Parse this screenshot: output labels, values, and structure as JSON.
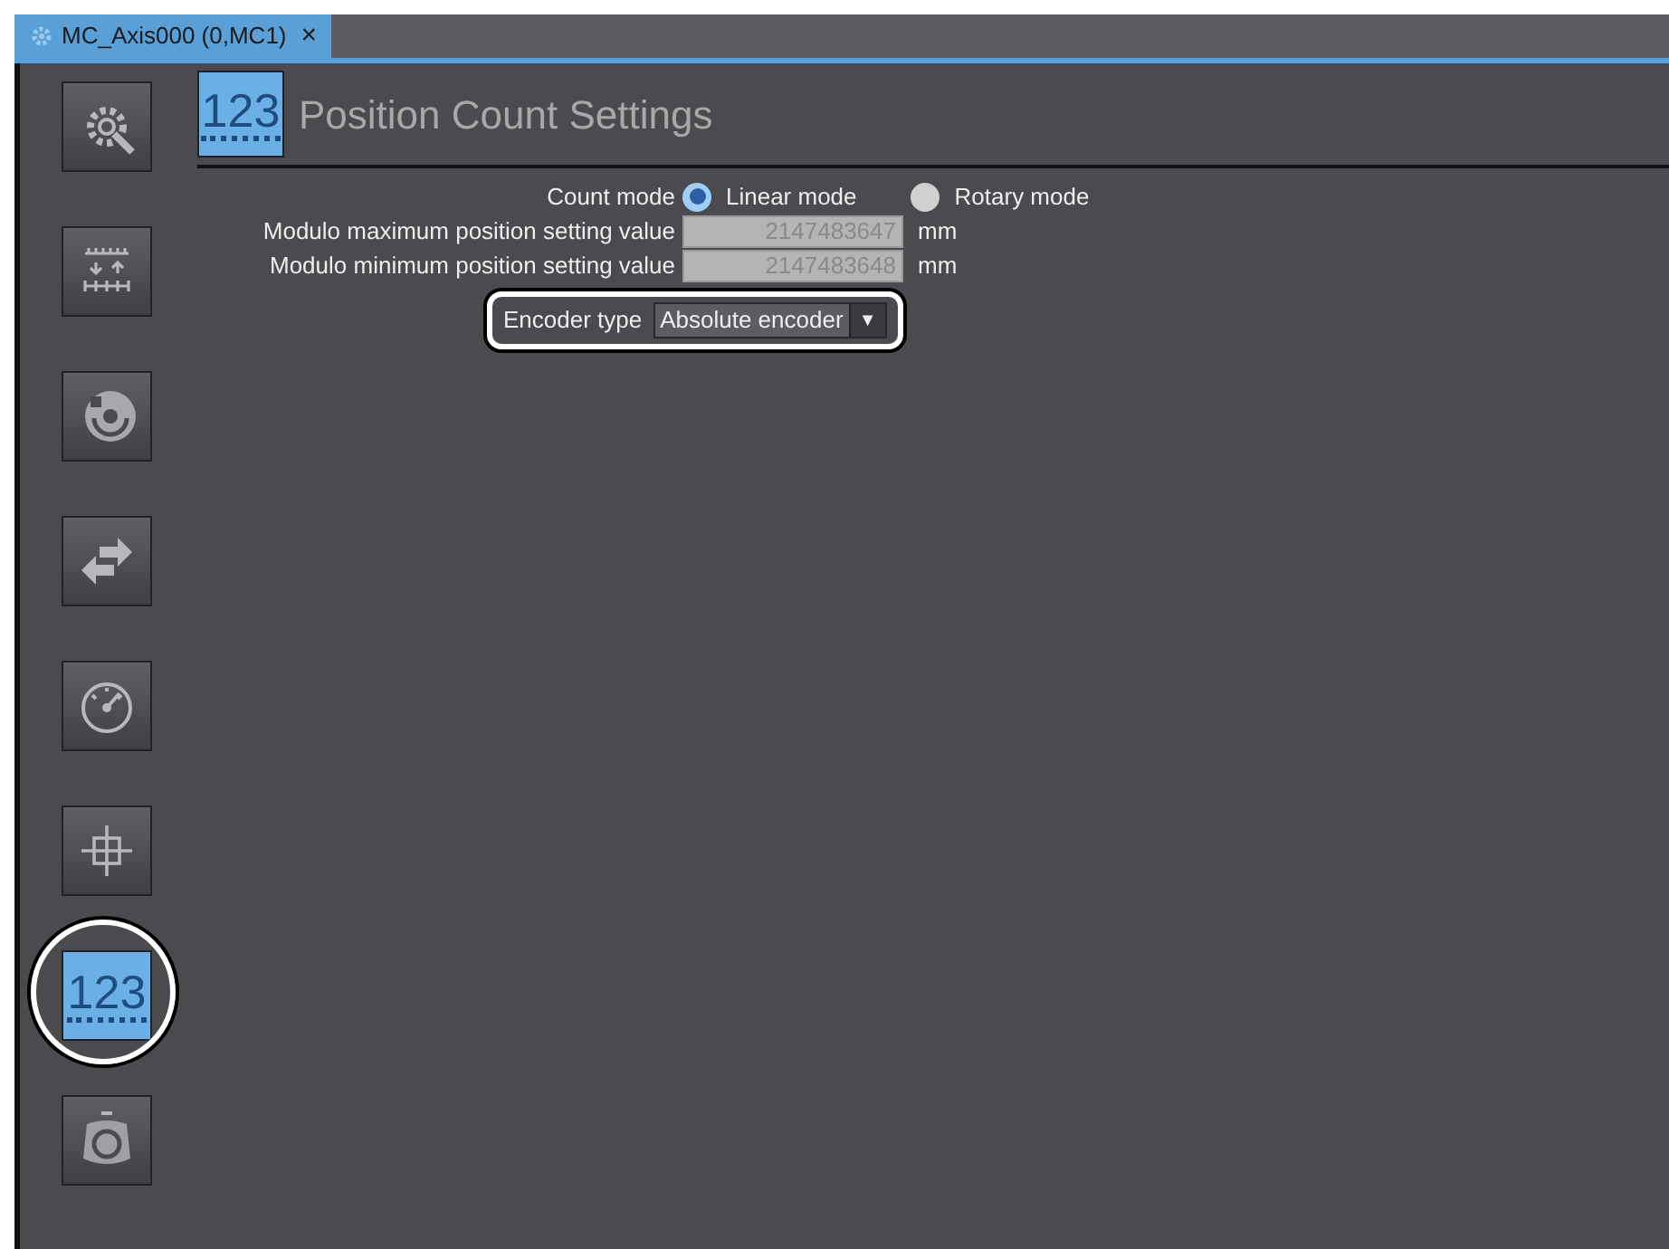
{
  "tab": {
    "title": "MC_Axis000 (0,MC1)",
    "close": "×"
  },
  "sidebar": {
    "items": [
      {
        "kind": "gear",
        "selected": false
      },
      {
        "kind": "scale",
        "selected": false
      },
      {
        "kind": "rotate",
        "selected": false
      },
      {
        "kind": "swap",
        "selected": false
      },
      {
        "kind": "gauge",
        "selected": false
      },
      {
        "kind": "crosshair",
        "selected": false
      },
      {
        "kind": "count",
        "label": "123",
        "selected": true
      },
      {
        "kind": "stopwatch",
        "selected": false
      }
    ]
  },
  "header": {
    "icon_label": "123",
    "title": "Position Count Settings"
  },
  "count_mode": {
    "label": "Count mode",
    "options": [
      {
        "label": "Linear mode",
        "selected": true
      },
      {
        "label": "Rotary mode",
        "selected": false
      }
    ]
  },
  "fields": [
    {
      "label": "Modulo maximum position setting value",
      "value": "2147483647",
      "unit": "mm"
    },
    {
      "label": "Modulo minimum position setting value",
      "value": "2147483648",
      "unit": "mm"
    }
  ],
  "encoder_type": {
    "label": "Encoder type",
    "value": "Absolute encoder",
    "arrow": "▼"
  }
}
